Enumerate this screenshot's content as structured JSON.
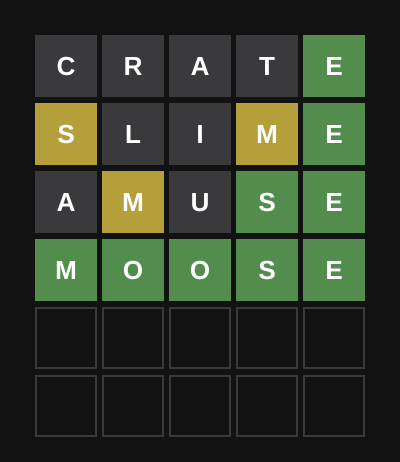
{
  "board": {
    "rows": [
      [
        {
          "letter": "C",
          "state": "absent"
        },
        {
          "letter": "R",
          "state": "absent"
        },
        {
          "letter": "A",
          "state": "absent"
        },
        {
          "letter": "T",
          "state": "absent"
        },
        {
          "letter": "E",
          "state": "correct"
        }
      ],
      [
        {
          "letter": "S",
          "state": "present"
        },
        {
          "letter": "L",
          "state": "absent"
        },
        {
          "letter": "I",
          "state": "absent"
        },
        {
          "letter": "M",
          "state": "present"
        },
        {
          "letter": "E",
          "state": "correct"
        }
      ],
      [
        {
          "letter": "A",
          "state": "absent"
        },
        {
          "letter": "M",
          "state": "present"
        },
        {
          "letter": "U",
          "state": "absent"
        },
        {
          "letter": "S",
          "state": "correct"
        },
        {
          "letter": "E",
          "state": "correct"
        }
      ],
      [
        {
          "letter": "M",
          "state": "correct"
        },
        {
          "letter": "O",
          "state": "correct"
        },
        {
          "letter": "O",
          "state": "correct"
        },
        {
          "letter": "S",
          "state": "correct"
        },
        {
          "letter": "E",
          "state": "correct"
        }
      ],
      [
        {
          "letter": "",
          "state": "empty"
        },
        {
          "letter": "",
          "state": "empty"
        },
        {
          "letter": "",
          "state": "empty"
        },
        {
          "letter": "",
          "state": "empty"
        },
        {
          "letter": "",
          "state": "empty"
        }
      ],
      [
        {
          "letter": "",
          "state": "empty"
        },
        {
          "letter": "",
          "state": "empty"
        },
        {
          "letter": "",
          "state": "empty"
        },
        {
          "letter": "",
          "state": "empty"
        },
        {
          "letter": "",
          "state": "empty"
        }
      ]
    ]
  },
  "colors": {
    "background": "#121213",
    "absent": "#3a3a3c",
    "present": "#b59f3b",
    "correct": "#538d4e",
    "empty_border": "#3a3a3c",
    "letter": "#ffffff"
  }
}
